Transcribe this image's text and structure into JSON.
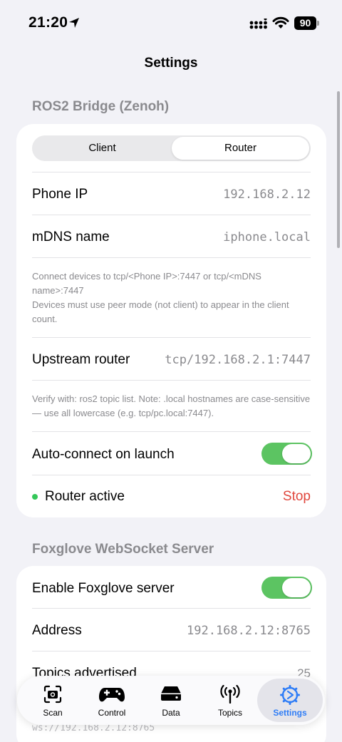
{
  "status_bar": {
    "time": "21:20",
    "battery": "90"
  },
  "nav": {
    "title": "Settings"
  },
  "ros2": {
    "header": "ROS2 Bridge (Zenoh)",
    "segments": [
      "Client",
      "Router"
    ],
    "selected_segment": "Router",
    "phone_ip_label": "Phone IP",
    "phone_ip_value": "192.168.2.12",
    "mdns_label": "mDNS name",
    "mdns_value": "iphone.local",
    "connect_note": "Connect devices to tcp/<Phone IP>:7447 or tcp/<mDNS name>:7447\nDevices must use peer mode (not client) to appear in the client count.",
    "upstream_label": "Upstream router",
    "upstream_value": "tcp/192.168.2.1:7447",
    "verify_note": "Verify with: ros2 topic list. Note: .local hostnames are case-sensitive — use all lowercase (e.g. tcp/pc.local:7447).",
    "autoconnect_label": "Auto-connect on launch",
    "autoconnect_on": true,
    "status_label": "Router active",
    "stop_label": "Stop"
  },
  "foxglove": {
    "header": "Foxglove WebSocket Server",
    "enable_label": "Enable Foxglove server",
    "enable_on": true,
    "address_label": "Address",
    "address_value": "192.168.2.12:8765",
    "topics_label": "Topics advertised",
    "topics_value": "25",
    "ws_url": "ws://192.168.2.12:8765"
  },
  "tabs": [
    {
      "label": "Scan",
      "icon": "camera-scan-icon"
    },
    {
      "label": "Control",
      "icon": "gamecontroller-icon"
    },
    {
      "label": "Data",
      "icon": "drive-icon"
    },
    {
      "label": "Topics",
      "icon": "antenna-icon"
    },
    {
      "label": "Settings",
      "icon": "gear-icon"
    }
  ],
  "active_tab": "Settings",
  "colors": {
    "accent": "#2f7df6",
    "toggle_on": "#5cc462",
    "stop": "#e0473d",
    "status_dot": "#34c759"
  }
}
